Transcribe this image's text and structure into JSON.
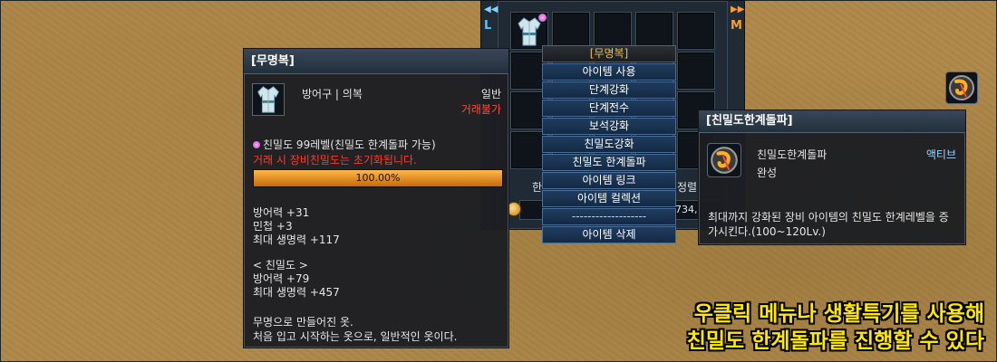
{
  "inventory": {
    "left_tag": "L",
    "right_tag": "M",
    "left_arrow": "◀◀",
    "right_arrow": "▶▶",
    "tab_fragment_left": "한",
    "tab_fragment_right": "정렬",
    "coin_value": "734,"
  },
  "item_tooltip": {
    "title": "[무명복]",
    "type": "방어구 | 의복",
    "grade": "일반",
    "trade": "거래불가",
    "level": "친밀도 99레벨(친밀도 한계돌파 가능)",
    "warning": "거래 시 장비친밀도는 초기화됩니다.",
    "progress_text": "100.00%",
    "progress_percent": 100,
    "stats": [
      "방어력 +31",
      "민첩 +3",
      "최대 생명력 +117"
    ],
    "bonus_header": "< 친밀도 >",
    "bonus": [
      "방어력 +79",
      "최대 생명력 +457"
    ],
    "description": [
      "무명으로 만들어진 옷.",
      "처음 입고 시작하는 옷으로, 일반적인 옷이다."
    ]
  },
  "context_menu": {
    "header": "[무명복]",
    "items": [
      "아이템 사용",
      "단계강화",
      "단계전수",
      "보석강화",
      "친밀도강화",
      "친밀도 한계돌파",
      "아이템 링크",
      "아이템 컬렉션",
      "-------------------",
      "아이템 삭제"
    ]
  },
  "skill_tooltip": {
    "title": "[친밀도한계돌파]",
    "name": "친밀도한계돌파",
    "state": "완성",
    "type": "액티브",
    "description": "최대까지 강화된 장비 아이템의 친밀도 한계레벨을 증가시킨다.(100~120Lv.)"
  },
  "caption": {
    "line1": "우클릭 메뉴나 생활특기를 사용해",
    "line2": "친밀도 한계돌파를 진행할 수 있다"
  },
  "colors": {
    "accent_cyan": "#3fd0ff",
    "accent_orange": "#ff9c2a",
    "warning_red": "#ff3a2a",
    "caption_yellow": "#ffe800"
  },
  "icons": {
    "robe": "robe-icon",
    "skill": "breakthrough-skill-icon",
    "coin": "coin-icon"
  }
}
